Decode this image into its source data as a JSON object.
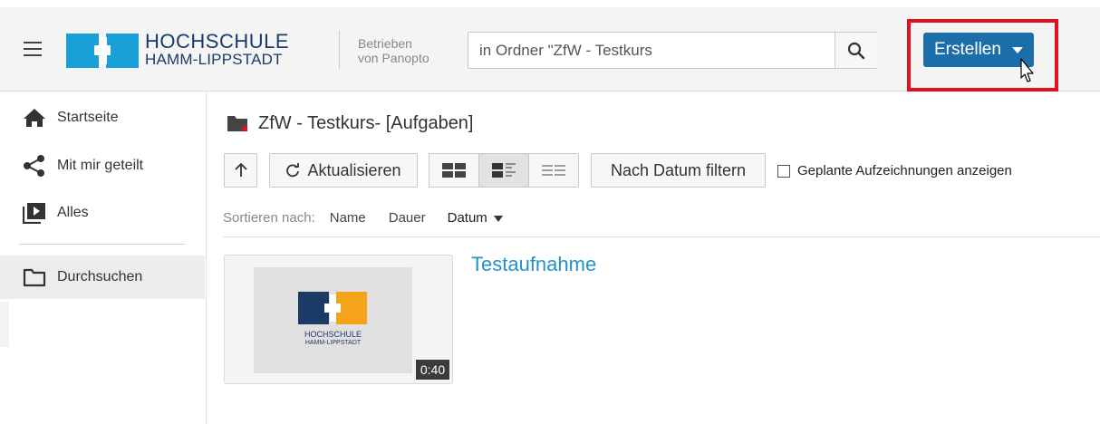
{
  "header": {
    "logo": {
      "line1": "HOCHSCHULE",
      "line2": "HAMM-LIPPSTADT"
    },
    "powered": {
      "line1": "Betrieben",
      "line2": "von Panopto"
    },
    "search": {
      "value": "in Ordner \"ZfW - Testkurs",
      "placeholder": ""
    },
    "create_label": "Erstellen"
  },
  "sidebar": {
    "items": [
      {
        "label": "Startseite",
        "icon": "home-icon"
      },
      {
        "label": "Mit mir geteilt",
        "icon": "share-icon"
      },
      {
        "label": "Alles",
        "icon": "play-library-icon"
      },
      {
        "label": "Durchsuchen",
        "icon": "folder-icon",
        "active": true
      }
    ]
  },
  "main": {
    "folder_title": "ZfW - Testkurs-  [Aufgaben]",
    "toolbar": {
      "refresh_label": "Aktualisieren",
      "filter_label": "Nach Datum filtern",
      "scheduled_label": "Geplante Aufzeichnungen anzeigen"
    },
    "sort": {
      "label": "Sortieren nach:",
      "options": [
        "Name",
        "Dauer",
        "Datum"
      ],
      "active": "Datum"
    },
    "sessions": [
      {
        "title": "Testaufnahme",
        "duration": "0:40",
        "thumb_line1": "HOCHSCHULE",
        "thumb_line2": "HAMM-LIPPSTADT"
      }
    ]
  },
  "colors": {
    "brand_blue": "#1b3a66",
    "logo_cyan": "#1aa0d8",
    "logo_orange": "#f5a31a",
    "create_button": "#1c6ea8",
    "highlight": "#e3101f",
    "link": "#2691c9"
  }
}
